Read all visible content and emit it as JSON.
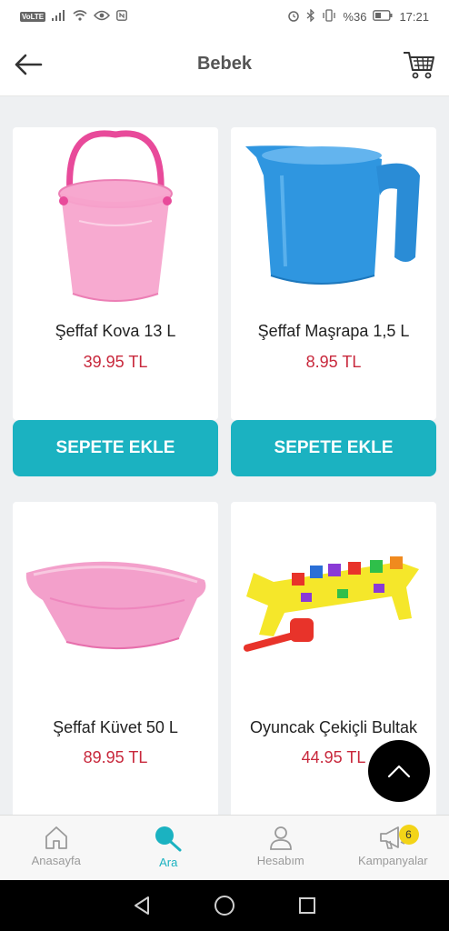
{
  "status_bar": {
    "volte": "VoLTE",
    "battery": "%36",
    "time": "17:21"
  },
  "header": {
    "title": "Bebek"
  },
  "products": [
    {
      "name": "Şeffaf Kova 13 L",
      "price": "39.95 TL",
      "button": "SEPETE EKLE",
      "color": "#f28fc3"
    },
    {
      "name": "Şeffaf Maşrapa 1,5 L",
      "price": "8.95 TL",
      "button": "SEPETE EKLE",
      "color": "#2f96e0"
    },
    {
      "name": "Şeffaf Küvet 50 L",
      "price": "89.95 TL",
      "color": "#f08cc0"
    },
    {
      "name": "Oyuncak Çekiçli Bultak",
      "price": "44.95 TL",
      "color": "#f5e72a"
    }
  ],
  "bottom_nav": {
    "items": [
      {
        "label": "Anasayfa",
        "icon": "home-icon"
      },
      {
        "label": "Ara",
        "icon": "search-icon"
      },
      {
        "label": "Hesabım",
        "icon": "user-icon"
      },
      {
        "label": "Kampanyalar",
        "icon": "megaphone-icon"
      }
    ],
    "active_index": 1,
    "campaign_badge": "6"
  },
  "colors": {
    "accent": "#1bb2c1",
    "price": "#c8283c",
    "badge": "#f3d418"
  }
}
